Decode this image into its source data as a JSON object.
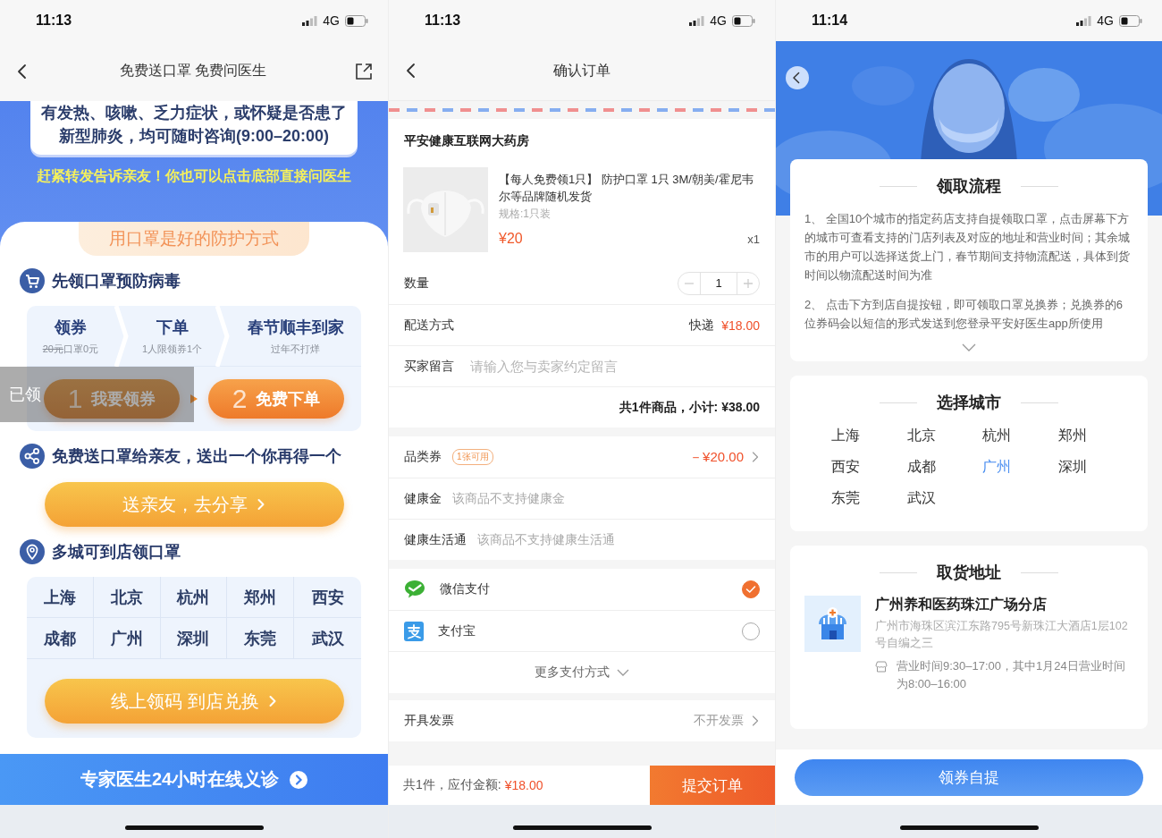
{
  "screens": [
    {
      "kind": "campaign",
      "status_bar": {
        "time": "11:13",
        "network": "4G"
      },
      "nav": {
        "title": "免费送口罩 免费问医生"
      },
      "notice_lines": [
        "有发热、咳嗽、乏力症状，或怀疑是否患了",
        "新型肺炎，均可随时咨询(9:00–20:00)"
      ],
      "share_tip": "赶紧转发告诉亲友！你也可以点击底部直接问医生",
      "tag": "用口罩是好的防护方式",
      "sections": [
        {
          "kind": "steps",
          "title": "先领口罩预防病毒",
          "steps": [
            {
              "title": "领券",
              "old_price": "20元",
              "sub": "口罩0元"
            },
            {
              "title": "下单",
              "sub": "1人限领券1个"
            },
            {
              "title": "春节顺丰到家",
              "sub": "过年不打烊"
            }
          ],
          "actions": [
            {
              "number": "1",
              "label": "我要领券",
              "claimed": true,
              "claimed_label": "已领"
            },
            {
              "number": "2",
              "label": "免费下单",
              "claimed": false
            }
          ]
        },
        {
          "kind": "button",
          "title": "免费送口罩给亲友，送出一个你再得一个",
          "button": "送亲友，去分享"
        },
        {
          "kind": "cities",
          "title": "多城可到店领口罩",
          "cities": [
            "上海",
            "北京",
            "杭州",
            "郑州",
            "西安",
            "成都",
            "广州",
            "深圳",
            "东莞",
            "武汉"
          ],
          "button": "线上领码 到店兑换"
        }
      ],
      "bottom_bar": "专家医生24小时在线义诊"
    },
    {
      "kind": "order",
      "status_bar": {
        "time": "11:13",
        "network": "4G"
      },
      "nav": {
        "title": "确认订单"
      },
      "store": "平安健康互联网大药房",
      "product": {
        "title": "【每人免费领1只】 防护口罩 1只 3M/朝美/霍尼韦尔等品牌随机发货",
        "spec": "规格:1只装",
        "price": "¥20",
        "quantity": "x1"
      },
      "quantity": {
        "label": "数量",
        "value": "1"
      },
      "delivery": {
        "label": "配送方式",
        "method": "快递",
        "fee": "¥18.00"
      },
      "message": {
        "label": "买家留言",
        "placeholder": "请输入您与卖家约定留言"
      },
      "subtotal": "共1件商品，小计: ¥38.00",
      "discounts": [
        {
          "label": "品类券",
          "badge": "1张可用",
          "amount": "－¥20.00"
        },
        {
          "label": "健康金",
          "note": "该商品不支持健康金"
        },
        {
          "label": "健康生活通",
          "note": "该商品不支持健康生活通"
        }
      ],
      "payments": [
        {
          "kind": "wechat",
          "name": "微信支付",
          "selected": true
        },
        {
          "kind": "alipay",
          "name": "支付宝",
          "selected": false
        }
      ],
      "more_payments": "更多支付方式",
      "invoice": {
        "label": "开具发票",
        "value": "不开发票"
      },
      "footer": {
        "summary": "共1件，应付金额:",
        "total": "¥18.00",
        "submit": "提交订单"
      }
    },
    {
      "kind": "pickup",
      "status_bar": {
        "time": "11:14",
        "network": "4G"
      },
      "process": {
        "title": "领取流程",
        "paragraphs": [
          "1、 全国10个城市的指定药店支持自提领取口罩，点击屏幕下方的城市可查看支持的门店列表及对应的地址和营业时间；其余城市的用户可以选择送货上门，春节期间支持物流配送，具体到货时间以物流配送时间为准",
          "2、 点击下方到店自提按钮，即可领取口罩兑换券；兑换券的6位券码会以短信的形式发送到您登录平安好医生app所使用"
        ]
      },
      "city_card": {
        "title": "选择城市",
        "cities": [
          {
            "name": "上海",
            "selected": false
          },
          {
            "name": "北京",
            "selected": false
          },
          {
            "name": "杭州",
            "selected": false
          },
          {
            "name": "郑州",
            "selected": false
          },
          {
            "name": "西安",
            "selected": false
          },
          {
            "name": "成都",
            "selected": false
          },
          {
            "name": "广州",
            "selected": true
          },
          {
            "name": "深圳",
            "selected": false
          },
          {
            "name": "东莞",
            "selected": false
          },
          {
            "name": "武汉",
            "selected": false
          }
        ]
      },
      "address": {
        "title": "取货地址",
        "store": "广州养和医药珠江广场分店",
        "address": "广州市海珠区滨江东路795号新珠江大酒店1层102号自编之三",
        "hours": "营业时间9:30–17:00，其中1月24日营业时间为8:00–16:00"
      },
      "button": "领券自提"
    }
  ]
}
